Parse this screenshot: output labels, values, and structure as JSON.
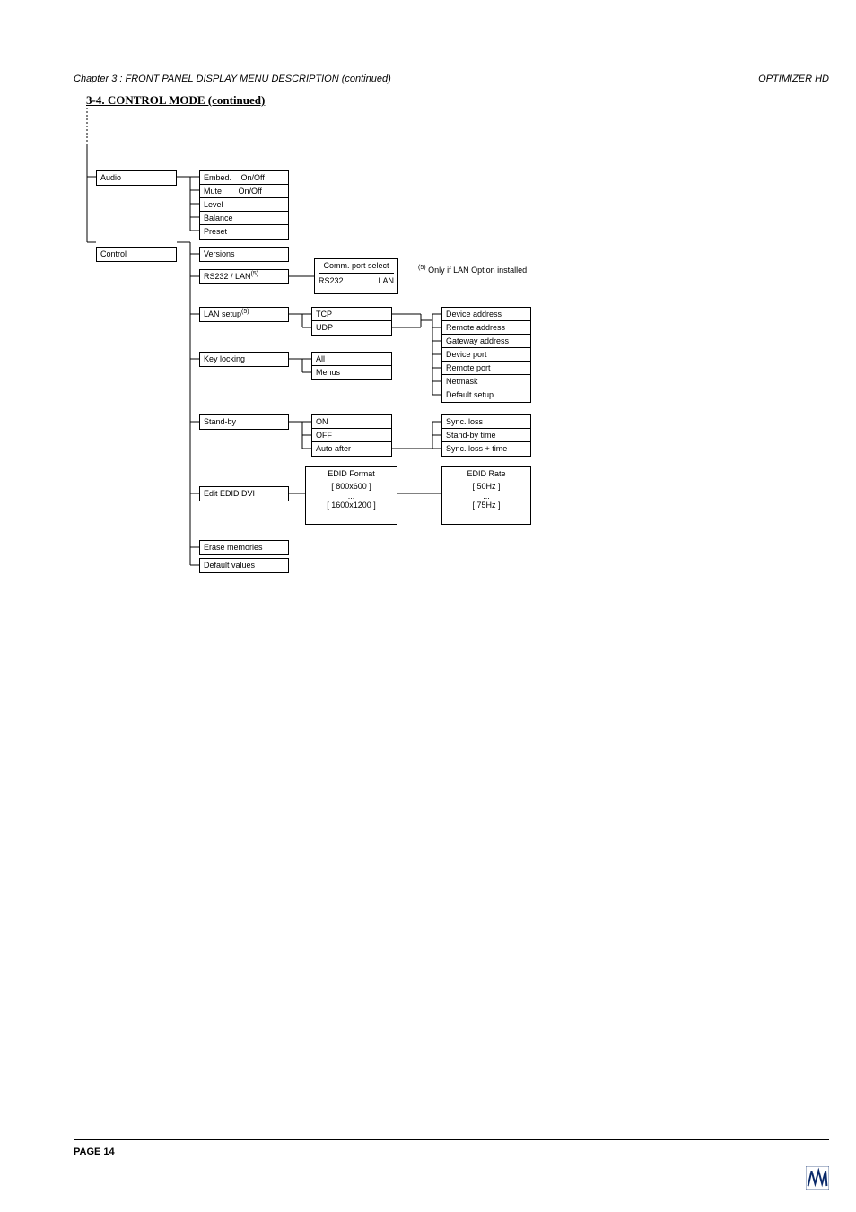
{
  "header": {
    "left": "Chapter 3 : FRONT PANEL DISPLAY MENU DESCRIPTION (continued)",
    "right": "OPTIMIZER HD"
  },
  "section_title": "3-4. CONTROL MODE (continued)",
  "footer": {
    "page": "PAGE 14"
  },
  "diagram": {
    "audio": {
      "label": "Audio",
      "items": {
        "embed": "Embed.",
        "embed_val": "On/Off",
        "mute": "Mute",
        "mute_val": "On/Off",
        "level": "Level",
        "balance": "Balance",
        "preset": "Preset"
      }
    },
    "control": {
      "label": "Control",
      "items": {
        "versions": "Versions",
        "rs232lan": "RS232 / LAN",
        "rs232lan_sup": "(5)",
        "lansetup": "LAN setup",
        "lansetup_sup": "(5)",
        "keylocking": "Key locking",
        "standby": "Stand-by",
        "editedid": "Edit EDID DVI",
        "erase": "Erase memories",
        "default": "Default values"
      },
      "commport": {
        "label": "Comm. port select",
        "opt1": "RS232",
        "opt2": "LAN"
      },
      "note": "Only if LAN Option installed",
      "note_sup": "(5)",
      "lan_proto": {
        "tcp": "TCP",
        "udp": "UDP"
      },
      "lan_params": {
        "p1": "Device address",
        "p2": "Remote address",
        "p3": "Gateway address",
        "p4": "Device port",
        "p5": "Remote port",
        "p6": "Netmask",
        "p7": "Default setup"
      },
      "keylock_opts": {
        "all": "All",
        "menus": "Menus"
      },
      "standby_opts": {
        "on": "ON",
        "off": "OFF",
        "auto": "Auto after"
      },
      "standby_detail": {
        "d1": "Sync. loss",
        "d2": "Stand-by time",
        "d3": "Sync. loss + time"
      },
      "edid_format": {
        "header": "EDID Format",
        "v1": "[   800x600   ]",
        "dots": "...",
        "v2": "[ 1600x1200 ]"
      },
      "edid_rate": {
        "header": "EDID Rate",
        "v1": "[   50Hz   ]",
        "dots": "...",
        "v2": "[   75Hz   ]"
      }
    }
  }
}
